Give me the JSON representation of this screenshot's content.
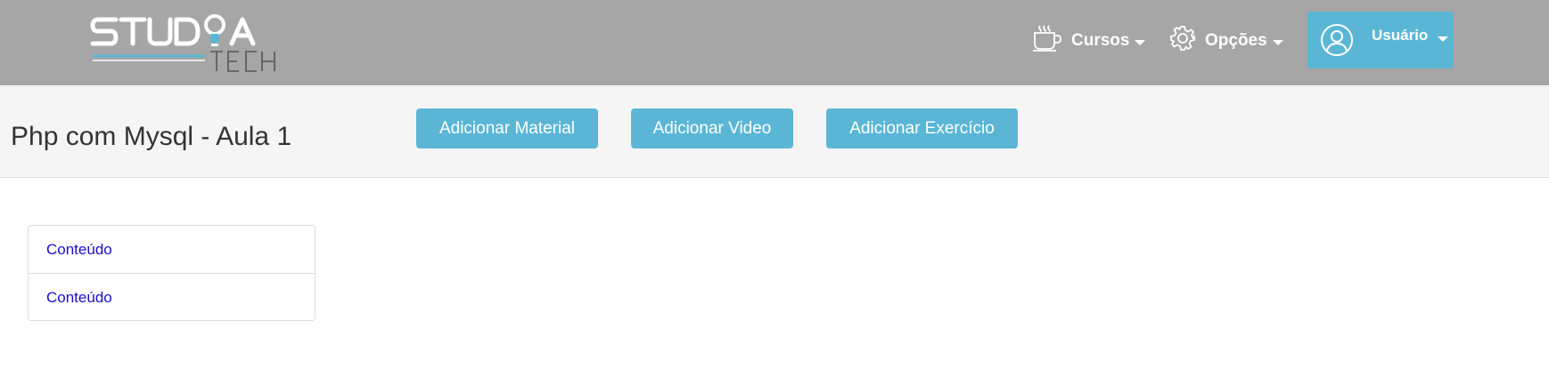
{
  "header": {
    "logo": {
      "title_text": "STUDIA",
      "subtitle_text": "TECH",
      "accent_color": "#5bb6d6"
    },
    "nav": [
      {
        "label": "Cursos",
        "icon": "coffee-cup-icon"
      },
      {
        "label": "Opções",
        "icon": "gear-icon"
      }
    ],
    "user": {
      "label": "Usuário",
      "icon": "user-avatar-icon"
    },
    "background_color": "#a6a6a6"
  },
  "toolbar": {
    "title": "Php com Mysql - Aula 1",
    "buttons": [
      {
        "label": "Adicionar Material"
      },
      {
        "label": "Adicionar Video"
      },
      {
        "label": "Adicionar Exercício"
      }
    ],
    "button_color": "#5bb6d6"
  },
  "content_list": {
    "items": [
      {
        "label": "Conteúdo"
      },
      {
        "label": "Conteúdo"
      }
    ],
    "link_color": "#1a0dcc"
  }
}
